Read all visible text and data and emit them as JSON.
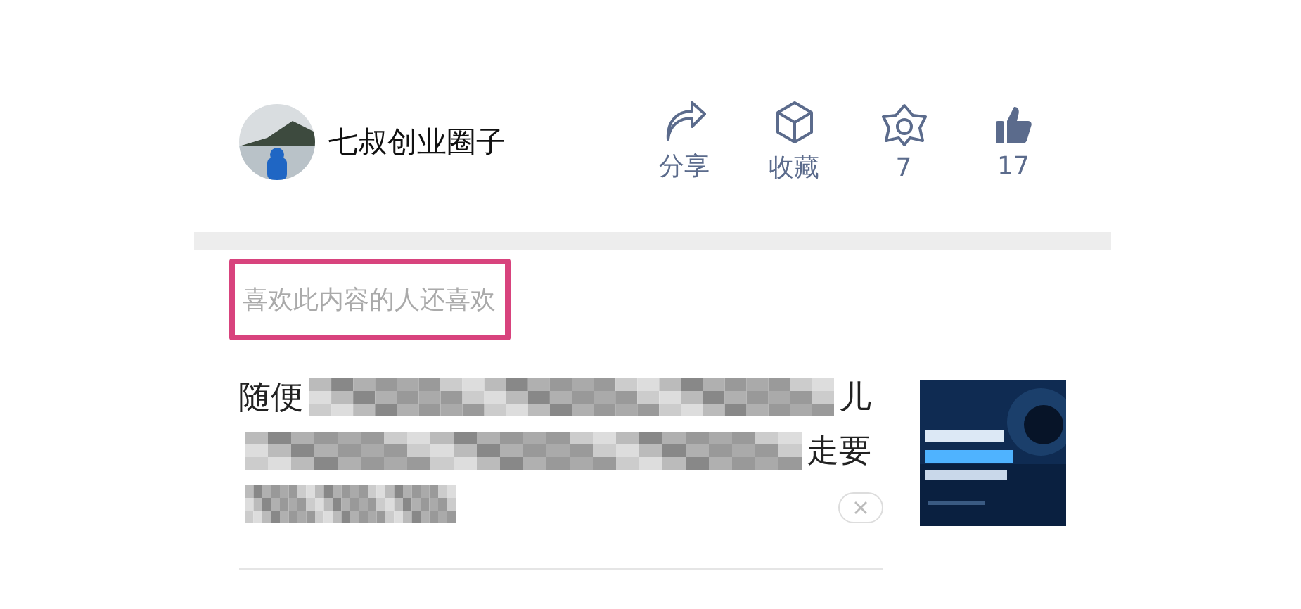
{
  "author": {
    "name": "七叔创业圈子"
  },
  "actions": [
    {
      "kind": "share",
      "label": "分享"
    },
    {
      "kind": "favorite",
      "label": "收藏"
    },
    {
      "kind": "star",
      "label": "7"
    },
    {
      "kind": "like",
      "label": "17"
    }
  ],
  "recommend": {
    "heading": "喜欢此内容的人还喜欢",
    "highlighted": true
  },
  "articles": [
    {
      "title_lines": [
        [
          {
            "kind": "text",
            "text": "随便"
          },
          {
            "kind": "redacted"
          },
          {
            "kind": "text",
            "text": "儿"
          }
        ],
        [
          {
            "kind": "redacted"
          },
          {
            "kind": "text",
            "text": "走要"
          }
        ],
        [
          {
            "kind": "redacted"
          }
        ]
      ],
      "thumbnail": {
        "kind": "picture"
      }
    }
  ]
}
